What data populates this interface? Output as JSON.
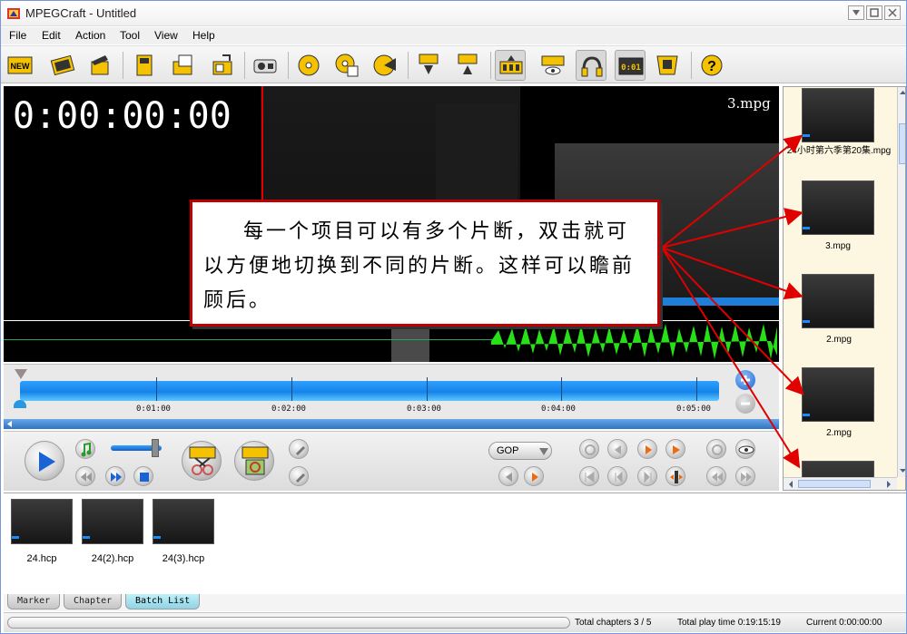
{
  "window": {
    "title": "MPEGCraft - Untitled",
    "icon": "mpegcraft-app-icon",
    "controls": [
      "minimize-icon",
      "maximize-icon",
      "close-icon"
    ]
  },
  "menu": [
    "File",
    "Edit",
    "Action",
    "Tool",
    "View",
    "Help"
  ],
  "toolbar": {
    "new_label": "NEW",
    "timecode_label": "0:01",
    "icons": [
      "new-project-icon",
      "open-movie-icon",
      "clapper-icon",
      "save-icon",
      "open-folder-icon",
      "export-icon",
      "camcorder-icon",
      "cd-icon",
      "dvd-menu-icon",
      "burn-disc-icon",
      "download-icon",
      "upload-icon",
      "scene-cut-icon",
      "preview-eye-icon",
      "headphones-icon",
      "timecode-icon",
      "film-clip-icon",
      "help-icon"
    ]
  },
  "video": {
    "timecode": "0:00:00:00",
    "clip_name": "3.mpg"
  },
  "timeline": {
    "ticks": [
      "0:01:00",
      "0:02:00",
      "0:03:00",
      "0:04:00",
      "0:05:00"
    ]
  },
  "controls": {
    "gop_label": "GOP",
    "icons": [
      "play-icon",
      "music-note-icon",
      "rewind-icon",
      "fast-forward-icon",
      "stop-icon",
      "cut-scissors-icon",
      "split-clip-icon",
      "marker-icon",
      "marker-remove-icon"
    ]
  },
  "clips": [
    {
      "label": "24小时第六季第20集.mpg"
    },
    {
      "label": "3.mpg"
    },
    {
      "label": "2.mpg"
    },
    {
      "label": "2.mpg"
    }
  ],
  "projects": [
    {
      "label": "24.hcp"
    },
    {
      "label": "24(2).hcp"
    },
    {
      "label": "24(3).hcp"
    }
  ],
  "tabs": [
    "Marker",
    "Chapter",
    "Batch List"
  ],
  "status": {
    "chapters": "Total chapters 3 / 5",
    "play_time": "Total play time 0:19:15:19",
    "current": "Current 0:00:00:00"
  },
  "callout": {
    "text": "每一个项目可以有多个片断，双击就可以方便地切换到不同的片断。这样可以瞻前顾后。"
  }
}
